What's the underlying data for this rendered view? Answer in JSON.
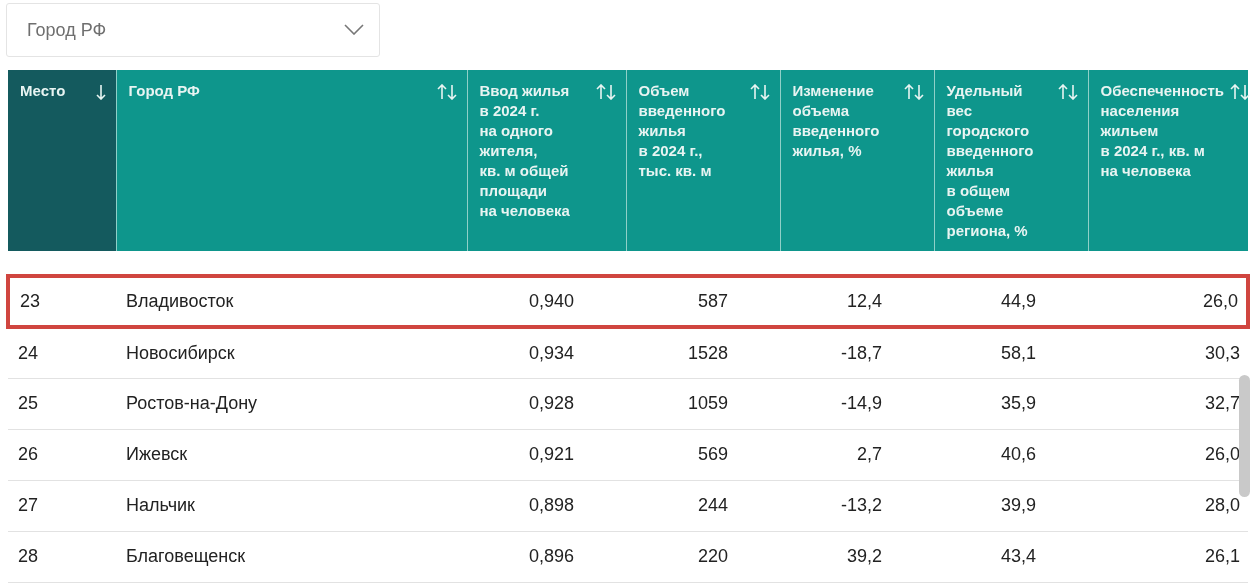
{
  "filter": {
    "placeholder": "Город РФ"
  },
  "table": {
    "columns": [
      {
        "label": "Место",
        "sorted": true
      },
      {
        "label": "Город РФ",
        "sorted": false
      },
      {
        "label": "Ввод жилья\nв 2024 г.\nна одного\nжителя,\nкв. м общей\nплощади\nна человека",
        "sorted": false
      },
      {
        "label": "Объем\nвведенного\nжилья\nв 2024 г.,\nтыс. кв. м",
        "sorted": false
      },
      {
        "label": "Изменение\nобъема\nвведенного\nжилья, %",
        "sorted": false
      },
      {
        "label": "Удельный\nвес\nгородского\nвведенного\nжилья\nв общем\nобъеме\nрегиона, %",
        "sorted": false
      },
      {
        "label": "Обеспеченность\nнаселения\nжильем\nв 2024 г., кв. м\nна человека",
        "sorted": false
      }
    ],
    "rows": [
      {
        "cells": [
          "23",
          "Владивосток",
          "0,940",
          "587",
          "12,4",
          "44,9",
          "26,0"
        ],
        "highlighted": true
      },
      {
        "cells": [
          "24",
          "Новосибирск",
          "0,934",
          "1528",
          "-18,7",
          "58,1",
          "30,3"
        ],
        "highlighted": false
      },
      {
        "cells": [
          "25",
          "Ростов-на-Дону",
          "0,928",
          "1059",
          "-14,9",
          "35,9",
          "32,7"
        ],
        "highlighted": false
      },
      {
        "cells": [
          "26",
          "Ижевск",
          "0,921",
          "569",
          "2,7",
          "40,6",
          "26,0"
        ],
        "highlighted": false
      },
      {
        "cells": [
          "27",
          "Нальчик",
          "0,898",
          "244",
          "-13,2",
          "39,9",
          "28,0"
        ],
        "highlighted": false
      },
      {
        "cells": [
          "28",
          "Благовещенск",
          "0,896",
          "220",
          "39,2",
          "43,4",
          "26,1"
        ],
        "highlighted": false
      }
    ]
  }
}
